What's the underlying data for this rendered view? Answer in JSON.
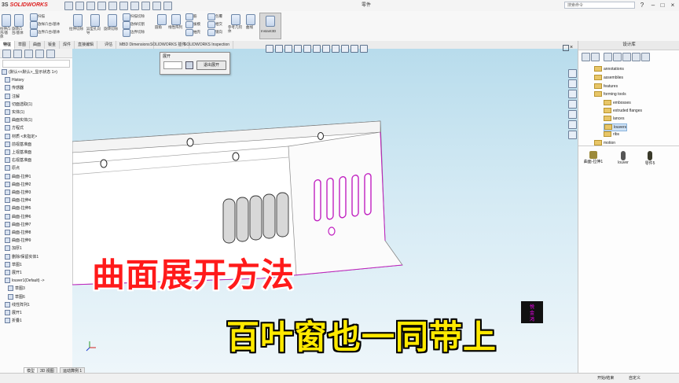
{
  "app": {
    "logo": "SOLIDWORKS",
    "logo_prefix": "3S",
    "doc_title": "零件"
  },
  "search": {
    "placeholder": "搜索命令"
  },
  "ribbon": {
    "groups": [
      {
        "label": "拉伸凸台/基体"
      },
      {
        "label": "旋转凸台/基体"
      },
      {
        "label": "边界凸台/基体"
      },
      {
        "label": "拉伸切除"
      },
      {
        "label": "异型孔向导"
      },
      {
        "label": "旋转切除"
      },
      {
        "label": "放样切割"
      },
      {
        "label": "边界切除"
      },
      {
        "label": "圆角"
      },
      {
        "label": "线性阵列"
      },
      {
        "label": "筋"
      },
      {
        "label": "拔模"
      },
      {
        "label": "抽壳"
      },
      {
        "label": "包覆"
      },
      {
        "label": "相交"
      },
      {
        "label": "镜向"
      },
      {
        "label": "参考几何体"
      },
      {
        "label": "曲线"
      },
      {
        "label": "Instant3D"
      }
    ]
  },
  "tabs": [
    "特征",
    "草图",
    "曲面",
    "钣金",
    "焊件",
    "直接编辑",
    "评估",
    "MBD Dimensions",
    "SOLIDWORKS 插件",
    "SOLIDWORKS Inspection"
  ],
  "dialog": {
    "title": "展开",
    "button": "退出展开"
  },
  "feature_tree": [
    "(默认<<默认>_显示状态 1>)",
    "History",
    "传感器",
    "注解",
    "切面选取(1)",
    "实体(1)",
    "曲面实体(1)",
    "方程式",
    "材质 <未指定>",
    "前视基准面",
    "上视基准面",
    "右视基准面",
    "原点",
    "曲面-拉伸1",
    "曲面-拉伸2",
    "曲面-拉伸3",
    "曲面-拉伸4",
    "曲面-拉伸5",
    "曲面-拉伸6",
    "曲面-拉伸7",
    "曲面-拉伸8",
    "曲面-拉伸9",
    "加厚1",
    "删除/保留实体1",
    "草图1",
    "展开1",
    "louver1(Default) ->",
    "草图3",
    "草图6",
    "线性阵列1",
    "展开1",
    "折叠1"
  ],
  "bottom_tabs": [
    "模型",
    "3D 视图",
    "运动算例 1"
  ],
  "right_panel": {
    "title": "设计库",
    "tree": [
      "annotations",
      "assemblies",
      "features",
      "forming tools",
      "embosses",
      "extruded flanges",
      "lances",
      "louvers",
      "ribs",
      "motion"
    ],
    "palette": [
      {
        "label": "曲面-拉伸1"
      },
      {
        "label": "louver"
      },
      {
        "label": "零件5"
      }
    ],
    "status_items": [
      "开始/结束",
      "自定义"
    ]
  },
  "captions": {
    "line1": "曲面展开方法",
    "line2": "百叶窗也一同带上"
  },
  "stamp": {
    "lines": [
      "悦",
      "金",
      "鸿"
    ]
  },
  "colors": {
    "caption1": "#ff1a1a",
    "caption2": "#ffe900",
    "viewport_top": "#b8dcec",
    "part_edge": "#c020c0"
  }
}
